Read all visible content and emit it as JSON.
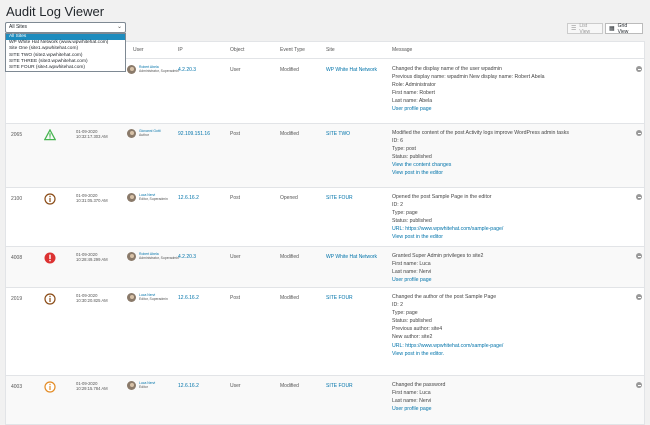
{
  "page_title": "Audit Log Viewer",
  "view_toggle": {
    "list_label": "List View",
    "grid_label": "Grid View",
    "active": "grid"
  },
  "site_filter": {
    "selected": "All Sites",
    "options": [
      "All Sites",
      "WP White Hat Network (www.wpwhitehat.com)",
      "Site One (site1.wpwhitehat.com)",
      "SITE TWO (site2.wpwhitehat.com)",
      "SITE THREE (site3.wpwhitehat.com)",
      "SITE FOUR (site4.wpwhitehat.com)"
    ]
  },
  "columns": {
    "id": "",
    "severity": "",
    "date": "",
    "user": "User",
    "ip": "IP",
    "object": "Object",
    "event_type": "Event Type",
    "site": "Site",
    "message": "Message"
  },
  "colors": {
    "link": "#0073aa",
    "warning": "#46b450",
    "critical": "#dc3232",
    "info": "#8a4b16",
    "medium": "#e38b24"
  },
  "rows": [
    {
      "id": "",
      "severity_icon": "",
      "date": "",
      "time": "",
      "user_name": "Robert Abela",
      "user_role": "Administrator, Superadmin",
      "ip": "4.2.20.3",
      "object": "User",
      "event_type": "Modified",
      "site": "WP White Hat Network",
      "message": [
        "Changed the display name of the user wpadmin",
        "Previous display name: wpadmin New display name: Robert Abela",
        "Role: Administrator",
        "First name: Robert",
        "Last name: Abela",
        "User profile page"
      ]
    },
    {
      "id": "2065",
      "severity_icon": "warning-triangle-icon",
      "date": "01-09-2020",
      "time": "10:32:17.303 AM",
      "user_name": "Giovanni Gotti",
      "user_role": "Author",
      "ip": "92.109.151.16",
      "object": "Post",
      "event_type": "Modified",
      "site": "SITE TWO",
      "message": [
        "Modified the content of the post Activity logs improve WordPress admin tasks",
        "ID: 6",
        "Type: post",
        "Status: published",
        "View the content changes",
        "View post in the editor"
      ]
    },
    {
      "id": "2100",
      "severity_icon": "info-icon",
      "date": "01-09-2020",
      "time": "10:31:05.370 AM",
      "user_name": "Luca Nervi",
      "user_role": "Editor, Superadmin",
      "ip": "12.6.16.2",
      "object": "Post",
      "event_type": "Opened",
      "site": "SITE FOUR",
      "message": [
        "Opened the post Sample Page in the editor",
        "ID: 2",
        "Type: page",
        "Status: published",
        "URL: https://www.wpwhitehat.com/sample-page/",
        "View post in the editor"
      ]
    },
    {
      "id": "4008",
      "severity_icon": "critical-icon",
      "date": "01-09-2020",
      "time": "10:28:49.299 AM",
      "user_name": "Robert Abela",
      "user_role": "Administrator, Superadmin",
      "ip": "4.2.20.3",
      "object": "User",
      "event_type": "Modified",
      "site": "WP White Hat Network",
      "message": [
        "Granted Super Admin privileges to site2",
        "First name: Luca",
        "Last name: Nervi",
        "User profile page"
      ]
    },
    {
      "id": "2019",
      "severity_icon": "info-icon",
      "date": "01-09-2020",
      "time": "10:30:20.825 AM",
      "user_name": "Luca Nervi",
      "user_role": "Editor, Superadmin",
      "ip": "12.6.16.2",
      "object": "Post",
      "event_type": "Modified",
      "site": "SITE FOUR",
      "message": [
        "Changed the author of the post Sample Page",
        "ID: 2",
        "Type: page",
        "Status: published",
        "Previous author: site4",
        "New author: site2",
        "URL: https://www.wpwhitehat.com/sample-page/",
        "View post in the editor."
      ]
    },
    {
      "id": "4003",
      "severity_icon": "medium-icon",
      "date": "01-09-2020",
      "time": "10:29:15.784 AM",
      "user_name": "Luca Nervi",
      "user_role": "Editor",
      "ip": "12.6.16.2",
      "object": "User",
      "event_type": "Modified",
      "site": "SITE FOUR",
      "message": [
        "Changed the password",
        "First name: Luca",
        "Last name: Nervi",
        "User profile page"
      ]
    }
  ]
}
